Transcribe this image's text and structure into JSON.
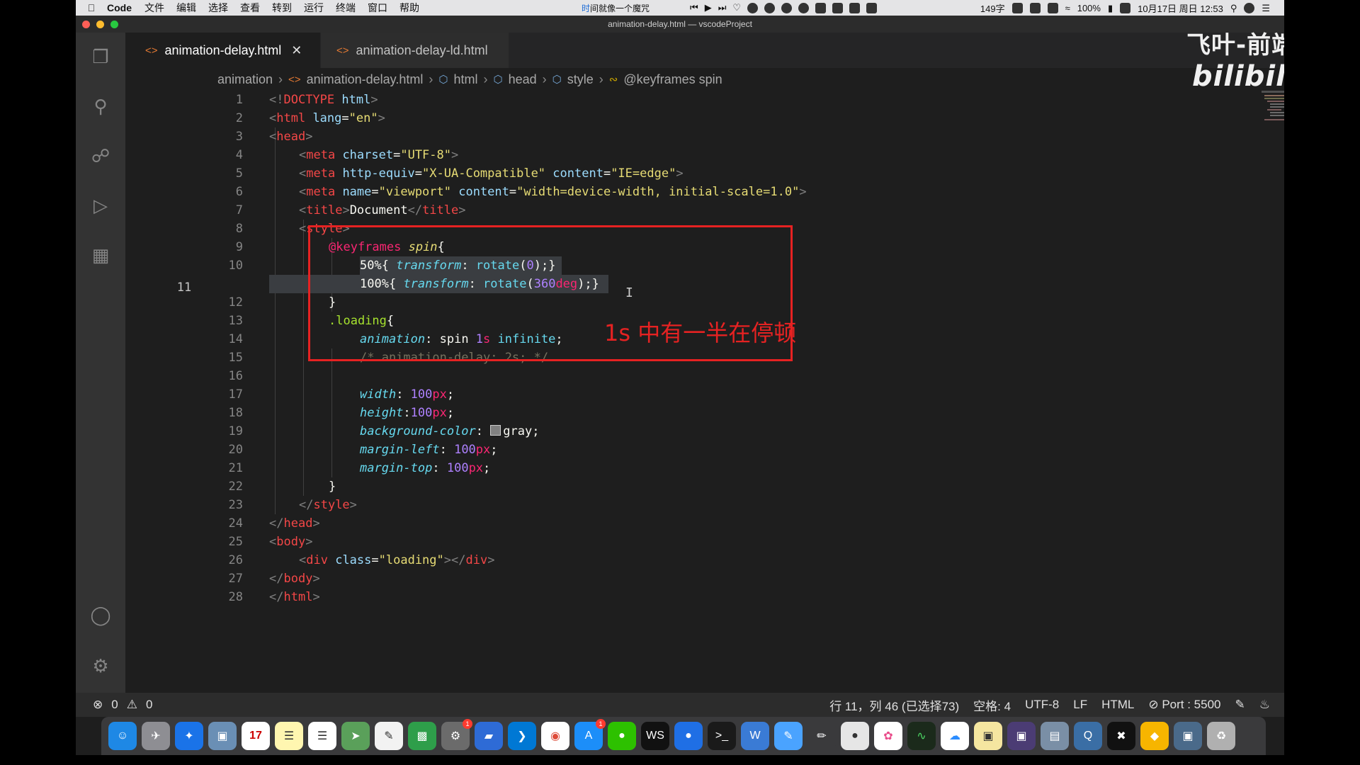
{
  "menubar": {
    "app": "Code",
    "items": [
      "文件",
      "编辑",
      "选择",
      "查看",
      "转到",
      "运行",
      "终端",
      "窗口",
      "帮助"
    ],
    "now_playing_a": "时",
    "now_playing_b": "间就像一个魔咒",
    "word_count": "149字",
    "battery": "100%",
    "date": "10月17日 周日 12:53"
  },
  "window": {
    "title": "animation-delay.html — vscodeProject"
  },
  "tabs": [
    {
      "label": "animation-delay.html",
      "active": true
    },
    {
      "label": "animation-delay-ld.html",
      "active": false
    }
  ],
  "breadcrumb": [
    "animation",
    "animation-delay.html",
    "html",
    "head",
    "style",
    "@keyframes spin"
  ],
  "editor": {
    "lines": [
      {
        "n": "1"
      },
      {
        "n": "2"
      },
      {
        "n": "3"
      },
      {
        "n": "4"
      },
      {
        "n": "5"
      },
      {
        "n": "6"
      },
      {
        "n": "7"
      },
      {
        "n": "8"
      },
      {
        "n": "9"
      },
      {
        "n": "10"
      },
      {
        "n": "11"
      },
      {
        "n": "12"
      },
      {
        "n": "13"
      },
      {
        "n": "14"
      },
      {
        "n": "15"
      },
      {
        "n": "16"
      },
      {
        "n": "17"
      },
      {
        "n": "18"
      },
      {
        "n": "19"
      },
      {
        "n": "20"
      },
      {
        "n": "21"
      },
      {
        "n": "22"
      },
      {
        "n": "23"
      },
      {
        "n": "24"
      },
      {
        "n": "25"
      },
      {
        "n": "26"
      },
      {
        "n": "27"
      },
      {
        "n": "28"
      }
    ],
    "active_line": 11,
    "code": {
      "l1": [
        "<!",
        "DOCTYPE",
        " html",
        ">"
      ],
      "l2": [
        "<",
        "html",
        " lang",
        "=",
        "\"en\"",
        ">"
      ],
      "l3": [
        "<",
        "head",
        ">"
      ],
      "l4": [
        "<",
        "meta",
        " charset",
        "=",
        "\"UTF-8\"",
        ">"
      ],
      "l5": [
        "<",
        "meta",
        " http-equiv",
        "=",
        "\"X-UA-Compatible\"",
        " content",
        "=",
        "\"IE=edge\"",
        ">"
      ],
      "l6": [
        "<",
        "meta",
        " name",
        "=",
        "\"viewport\"",
        " content",
        "=",
        "\"width=device-width, initial-scale=1.0\"",
        ">"
      ],
      "l7": [
        "<",
        "title",
        ">",
        "Document",
        "</",
        "title",
        ">"
      ],
      "l8": [
        "<",
        "style",
        ">"
      ],
      "l9": [
        "@keyframes",
        " spin",
        "{"
      ],
      "l10": [
        "50%",
        "{ ",
        "transform",
        ": ",
        "rotate",
        "(",
        "0",
        ");}"
      ],
      "l11": [
        "100%",
        "{ ",
        "transform",
        ": ",
        "rotate",
        "(",
        "360",
        "deg",
        ");}"
      ],
      "l12": [
        "}"
      ],
      "l13": [
        ".loading",
        "{"
      ],
      "l14": [
        "animation",
        ": ",
        "spin ",
        "1",
        "s",
        " infinite",
        ";"
      ],
      "l15": [
        "/* animation-delay: 2s; */"
      ],
      "l17": [
        "width",
        ": ",
        "100",
        "px",
        ";"
      ],
      "l18": [
        "height",
        ":",
        "100",
        "px",
        ";"
      ],
      "l19": [
        "background-color",
        ": ",
        "gray",
        ";"
      ],
      "l20": [
        "margin-left",
        ": ",
        "100",
        "px",
        ";"
      ],
      "l21": [
        "margin-top",
        ": ",
        "100",
        "px",
        ";"
      ],
      "l22": [
        "}"
      ],
      "l23": [
        "</",
        "style",
        ">"
      ],
      "l24": [
        "</",
        "head",
        ">"
      ],
      "l25": [
        "<",
        "body",
        ">"
      ],
      "l26": [
        "<",
        "div",
        " class",
        "=",
        "\"loading\"",
        ">",
        "</",
        "div",
        ">"
      ],
      "l27": [
        "</",
        "body",
        ">"
      ],
      "l28": [
        "</",
        "html",
        ">"
      ]
    }
  },
  "annotation": {
    "text": "1s 中有一半在停顿",
    "color": "#e62222"
  },
  "watermark": {
    "text": "飞叶-前端",
    "brand": "bilibili"
  },
  "statusbar": {
    "errors": "0",
    "warnings": "0",
    "position": "行 11，列 46 (已选择73)",
    "spaces": "空格: 4",
    "encoding": "UTF-8",
    "eol": "LF",
    "language": "HTML",
    "port": "Port : 5500"
  },
  "settings_badge": "1",
  "dock_icons": [
    "finder-icon",
    "launchpad-icon",
    "safari-icon",
    "preview-icon",
    "calendar-icon",
    "notes-icon",
    "reminders-icon",
    "maps-icon",
    "textedit-icon",
    "numbers-icon",
    "system-preferences-icon",
    "keynote-icon",
    "vscode-icon",
    "chrome-icon",
    "app-store-icon",
    "wechat-icon",
    "webstorm-icon",
    "maps-pin-icon",
    "terminal-icon",
    "wps-icon",
    "pencil-app-icon",
    "draw-icon",
    "messages-icon",
    "photos-icon",
    "activity-monitor-icon",
    "baidu-netdisk-icon",
    "stickies-icon",
    "screenshot-icon",
    "image-capture-icon",
    "quicktime-icon",
    "capcut-icon",
    "sketch-icon",
    "desktop-icon",
    "trash-icon"
  ],
  "calendar_day": "17",
  "dock_badge_prefs": "1",
  "dock_badge_appstore": "1",
  "colors": {
    "accent": "#0e70c0",
    "annotation": "#e62222",
    "editor_bg": "#1e1e1e"
  }
}
